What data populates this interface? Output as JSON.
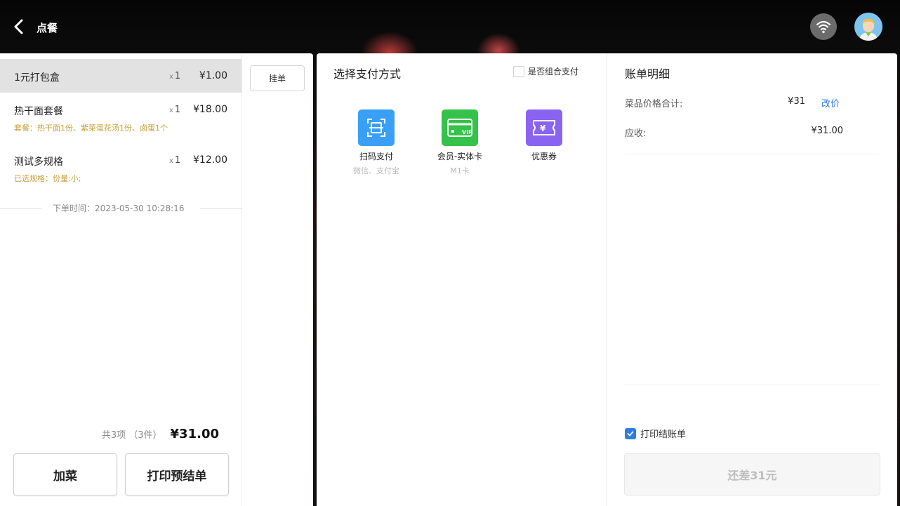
{
  "header": {
    "title": "点餐"
  },
  "order": {
    "items": [
      {
        "name": "1元打包盒",
        "qty": "1",
        "price": "¥1.00",
        "note": ""
      },
      {
        "name": "热干面套餐",
        "qty": "1",
        "price": "¥18.00",
        "note": "套餐：热干面1份、紫菜蛋花汤1份、卤蛋1个"
      },
      {
        "name": "测试多规格",
        "qty": "1",
        "price": "¥12.00",
        "note": "已选规格：份量:小;"
      }
    ],
    "qty_prefix": "x",
    "order_time": "下单时间：2023-05-30 10:28:16",
    "summary_count": "共3项 （3件）",
    "total": "¥31.00",
    "add_dish_label": "加菜",
    "print_pre_bill_label": "打印预结单",
    "hang_label": "挂单"
  },
  "payment": {
    "title": "选择支付方式",
    "combine_label": "是否组合支付",
    "combine_checked": false,
    "methods": [
      {
        "name": "扫码支付",
        "sub": "微信、支付宝",
        "icon": "scan-icon",
        "color": "#3aa0f5"
      },
      {
        "name": "会员-实体卡",
        "sub": "M1卡",
        "icon": "vip-card-icon",
        "color": "#34c24a"
      },
      {
        "name": "优惠券",
        "sub": "",
        "icon": "coupon-icon",
        "color": "#8a63f0"
      }
    ]
  },
  "bill": {
    "title": "账单明细",
    "dish_total_label": "菜品价格合计:",
    "dish_total_value": "¥31",
    "change_price_label": "改价",
    "receivable_label": "应收:",
    "receivable_value": "¥31.00",
    "print_bill_label": "打印结账单",
    "print_bill_checked": true,
    "pay_button_label": "还差31元"
  },
  "colors": {
    "accent": "#2f7de1",
    "note": "#c9a13c",
    "selected_row": "#e2e2e2"
  }
}
